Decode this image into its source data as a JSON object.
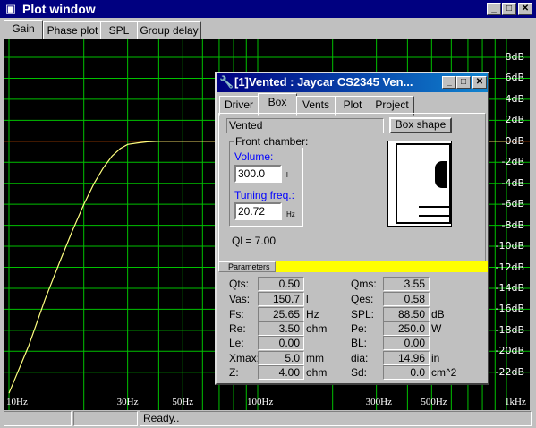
{
  "window": {
    "title": "Plot window"
  },
  "tabs": [
    {
      "label": "Gain",
      "active": true
    },
    {
      "label": "Phase plot",
      "active": false
    },
    {
      "label": "SPL",
      "active": false
    },
    {
      "label": "Group delay",
      "active": false
    }
  ],
  "plot": {
    "y_ticks": [
      "8dB",
      "6dB",
      "4dB",
      "2dB",
      "0dB",
      "-2dB",
      "-4dB",
      "-6dB",
      "-8dB",
      "-10dB",
      "-12dB",
      "-14dB",
      "-16dB",
      "-18dB",
      "-20dB",
      "-22dB"
    ],
    "x_ticks": [
      "10Hz",
      "30Hz",
      "50Hz",
      "100Hz",
      "300Hz",
      "500Hz",
      "1kHz"
    ],
    "colors": {
      "background": "#000000",
      "grid": "#00c000",
      "reference": "#ff0000",
      "curve": "#ffff80"
    }
  },
  "chart_data": {
    "type": "line",
    "x_scale": "log",
    "xlim": [
      10,
      1000
    ],
    "ylim": [
      -24,
      9
    ],
    "grid": true,
    "series": [
      {
        "x": [
          10,
          12,
          14,
          16,
          18,
          20,
          22,
          24,
          26,
          28,
          30,
          33,
          36,
          40,
          50,
          100,
          300,
          1000
        ],
        "values": [
          -24,
          -19.5,
          -15,
          -11.5,
          -8.5,
          -6,
          -4,
          -2.5,
          -1.4,
          -0.7,
          -0.3,
          -0.15,
          -0.05,
          0,
          0,
          0,
          0,
          0
        ]
      }
    ],
    "reference_line": 0
  },
  "status": {
    "text": "Ready.."
  },
  "dialog": {
    "title": "[1]Vented : Jaycar CS2345 Ven...",
    "tabs": [
      {
        "label": "Driver",
        "active": false
      },
      {
        "label": "Box",
        "active": true
      },
      {
        "label": "Vents",
        "active": false
      },
      {
        "label": "Plot",
        "active": false
      },
      {
        "label": "Project",
        "active": false
      }
    ],
    "box_type": "Vented",
    "box_shape_button": "Box shape",
    "front_chamber": {
      "label": "Front chamber:",
      "volume_label": "Volume:",
      "volume_value": "300.0",
      "volume_unit": "l",
      "tuning_label": "Tuning freq.:",
      "tuning_value": "20.72",
      "tuning_unit": "Hz"
    },
    "ql": "Ql = 7.00",
    "parameters_label": "Parameters",
    "params_left": [
      {
        "label": "Qts:",
        "value": "0.50",
        "unit": ""
      },
      {
        "label": "Vas:",
        "value": "150.7",
        "unit": "l"
      },
      {
        "label": "Fs:",
        "value": "25.65",
        "unit": "Hz"
      },
      {
        "label": "Re:",
        "value": "3.50",
        "unit": "ohm"
      },
      {
        "label": "Le:",
        "value": "0.00",
        "unit": ""
      },
      {
        "label": "Xmax:",
        "value": "5.0",
        "unit": "mm"
      },
      {
        "label": "Z:",
        "value": "4.00",
        "unit": "ohm"
      }
    ],
    "params_right": [
      {
        "label": "Qms:",
        "value": "3.55",
        "unit": ""
      },
      {
        "label": "Qes:",
        "value": "0.58",
        "unit": ""
      },
      {
        "label": "SPL:",
        "value": "88.50",
        "unit": "dB"
      },
      {
        "label": "Pe:",
        "value": "250.0",
        "unit": "W"
      },
      {
        "label": "BL:",
        "value": "0.00",
        "unit": ""
      },
      {
        "label": "dia:",
        "value": "14.96",
        "unit": "in"
      },
      {
        "label": "Sd:",
        "value": "0.0",
        "unit": "cm^2"
      }
    ]
  }
}
